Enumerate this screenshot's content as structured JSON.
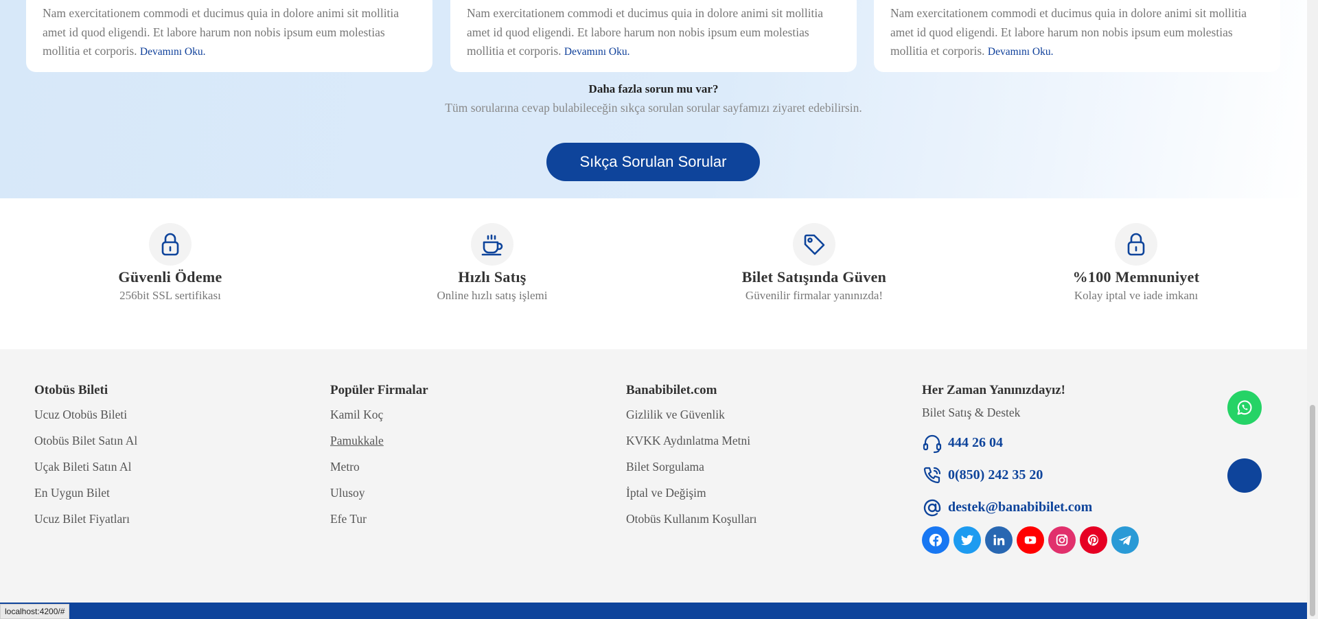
{
  "faq": {
    "cards": [
      {
        "text": "Nam exercitationem commodi et ducimus quia in dolore animi sit mollitia amet id quod eligendi. Et labore harum non nobis ipsum eum molestias mollitia et corporis.",
        "more": "Devamını Oku."
      },
      {
        "text": "Nam exercitationem commodi et ducimus quia in dolore animi sit mollitia amet id quod eligendi. Et labore harum non nobis ipsum eum molestias mollitia et corporis.",
        "more": "Devamını Oku."
      },
      {
        "text": "Nam exercitationem commodi et ducimus quia in dolore animi sit mollitia amet id quod eligendi. Et labore harum non nobis ipsum eum molestias mollitia et corporis.",
        "more": "Devamını Oku."
      }
    ],
    "title": "Daha fazla sorun mu var?",
    "subtitle": "Tüm sorularına cevap bulabileceğin sıkça sorulan sorular sayfamızı ziyaret edebilirsin.",
    "button": "Sıkça Sorulan Sorular"
  },
  "features": [
    {
      "icon": "lock-icon",
      "title": "Güvenli Ödeme",
      "subtitle": "256bit SSL sertifikası"
    },
    {
      "icon": "coffee-cup-icon",
      "title": "Hızlı Satış",
      "subtitle": "Online hızlı satış işlemi"
    },
    {
      "icon": "tag-icon",
      "title": "Bilet Satışında Güven",
      "subtitle": "Güvenilir firmalar yanınızda!"
    },
    {
      "icon": "lock-icon",
      "title": "%100 Memnuniyet",
      "subtitle": "Kolay iptal ve iade imkanı"
    }
  ],
  "footer": {
    "columns": [
      {
        "title": "Otobüs Bileti",
        "links": [
          "Ucuz Otobüs Bileti",
          "Otobüs Bilet Satın Al",
          "Uçak Bileti Satın Al",
          "En Uygun Bilet",
          "Ucuz Bilet Fiyatları"
        ]
      },
      {
        "title": "Popüler Firmalar",
        "links": [
          "Kamil Koç",
          "Pamukkale",
          "Metro",
          "Ulusoy",
          "Efe Tur"
        ]
      },
      {
        "title": "Banabibilet.com",
        "links": [
          "Gizlilik ve Güvenlik",
          "KVKK Aydınlatma Metni",
          "Bilet Sorgulama",
          "İptal ve Değişim",
          "Otobüs Kullanım Koşulları"
        ]
      }
    ],
    "contact": {
      "title": "Her Zaman Yanınızdayız!",
      "subtitle": "Bilet Satış & Destek",
      "phone1": "444 26 04",
      "phone2": "0(850) 242 35 20",
      "email": "destek@banabibilet.com"
    },
    "socials": [
      {
        "icon": "facebook-icon",
        "color": "#1877f2"
      },
      {
        "icon": "twitter-icon",
        "color": "#1d9bf0"
      },
      {
        "icon": "linkedin-icon",
        "color": "#2867b2"
      },
      {
        "icon": "youtube-icon",
        "color": "#ff0000"
      },
      {
        "icon": "instagram-icon",
        "color": "#e1306c"
      },
      {
        "icon": "pinterest-icon",
        "color": "#e60023"
      },
      {
        "icon": "telegram-icon",
        "color": "#2a9ad6"
      }
    ]
  },
  "floating": {
    "whatsapp_color": "#25d366",
    "scroll_top_color": "#0e449b"
  },
  "status_url": "localhost:4200/#",
  "colors": {
    "brand": "#0e449b",
    "link": "#0e3f9a"
  }
}
